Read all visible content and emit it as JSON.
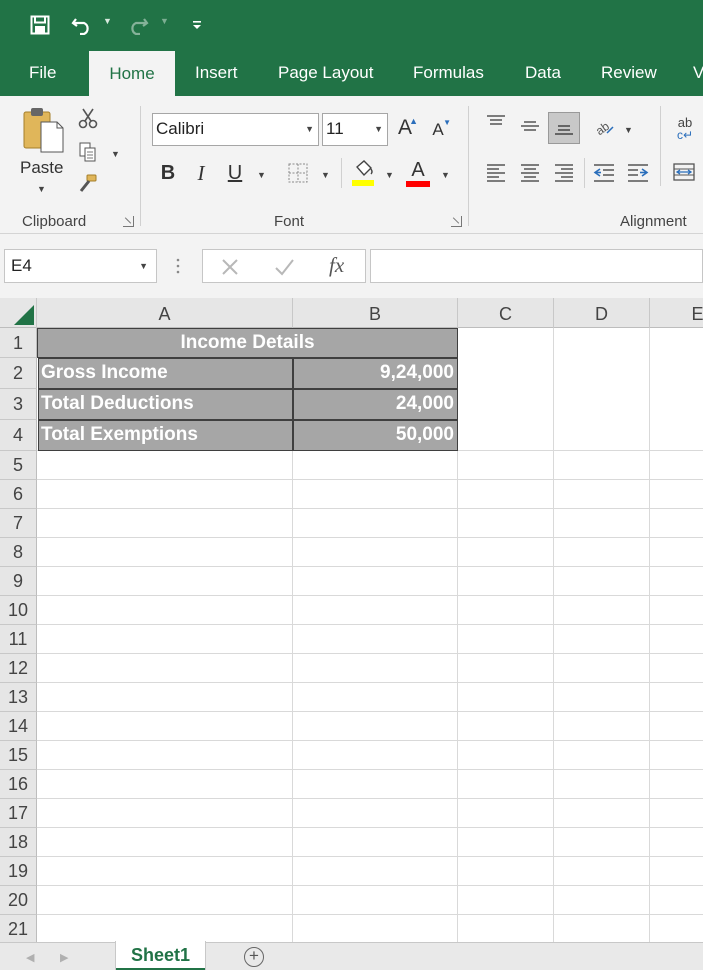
{
  "tabs": [
    "File",
    "Home",
    "Insert",
    "Page Layout",
    "Formulas",
    "Data",
    "Review",
    "V"
  ],
  "ribbon": {
    "clipboard": {
      "paste_label": "Paste",
      "group_label": "Clipboard"
    },
    "font": {
      "font_name": "Calibri",
      "font_size": "11",
      "group_label": "Font",
      "bold": "B",
      "italic": "I",
      "underline": "U",
      "font_color_glyph": "A",
      "grow_glyph": "A",
      "shrink_glyph": "A"
    },
    "alignment": {
      "group_label": "Alignment",
      "wrap_glyph": "ab"
    }
  },
  "formula_bar": {
    "name_box": "E4",
    "fx_label": "fx",
    "formula": ""
  },
  "columns": [
    "A",
    "B",
    "C",
    "D",
    "E"
  ],
  "rows": [
    "1",
    "2",
    "3",
    "4",
    "5",
    "6",
    "7",
    "8",
    "9",
    "10",
    "11",
    "12",
    "13",
    "14",
    "15",
    "16",
    "17",
    "18",
    "19",
    "20",
    "21"
  ],
  "table": {
    "title": "Income Details",
    "rows": [
      {
        "label": "Gross Income",
        "value": "9,24,000"
      },
      {
        "label": "Total Deductions",
        "value": "24,000"
      },
      {
        "label": "Total Exemptions",
        "value": "50,000"
      }
    ]
  },
  "sheets": {
    "active": "Sheet1",
    "add_glyph": "+"
  },
  "colors": {
    "brand": "#217346",
    "cell_fill": "#a6a6a6",
    "highlight_bar": "#ffff00",
    "font_color_bar": "#ff0000"
  }
}
